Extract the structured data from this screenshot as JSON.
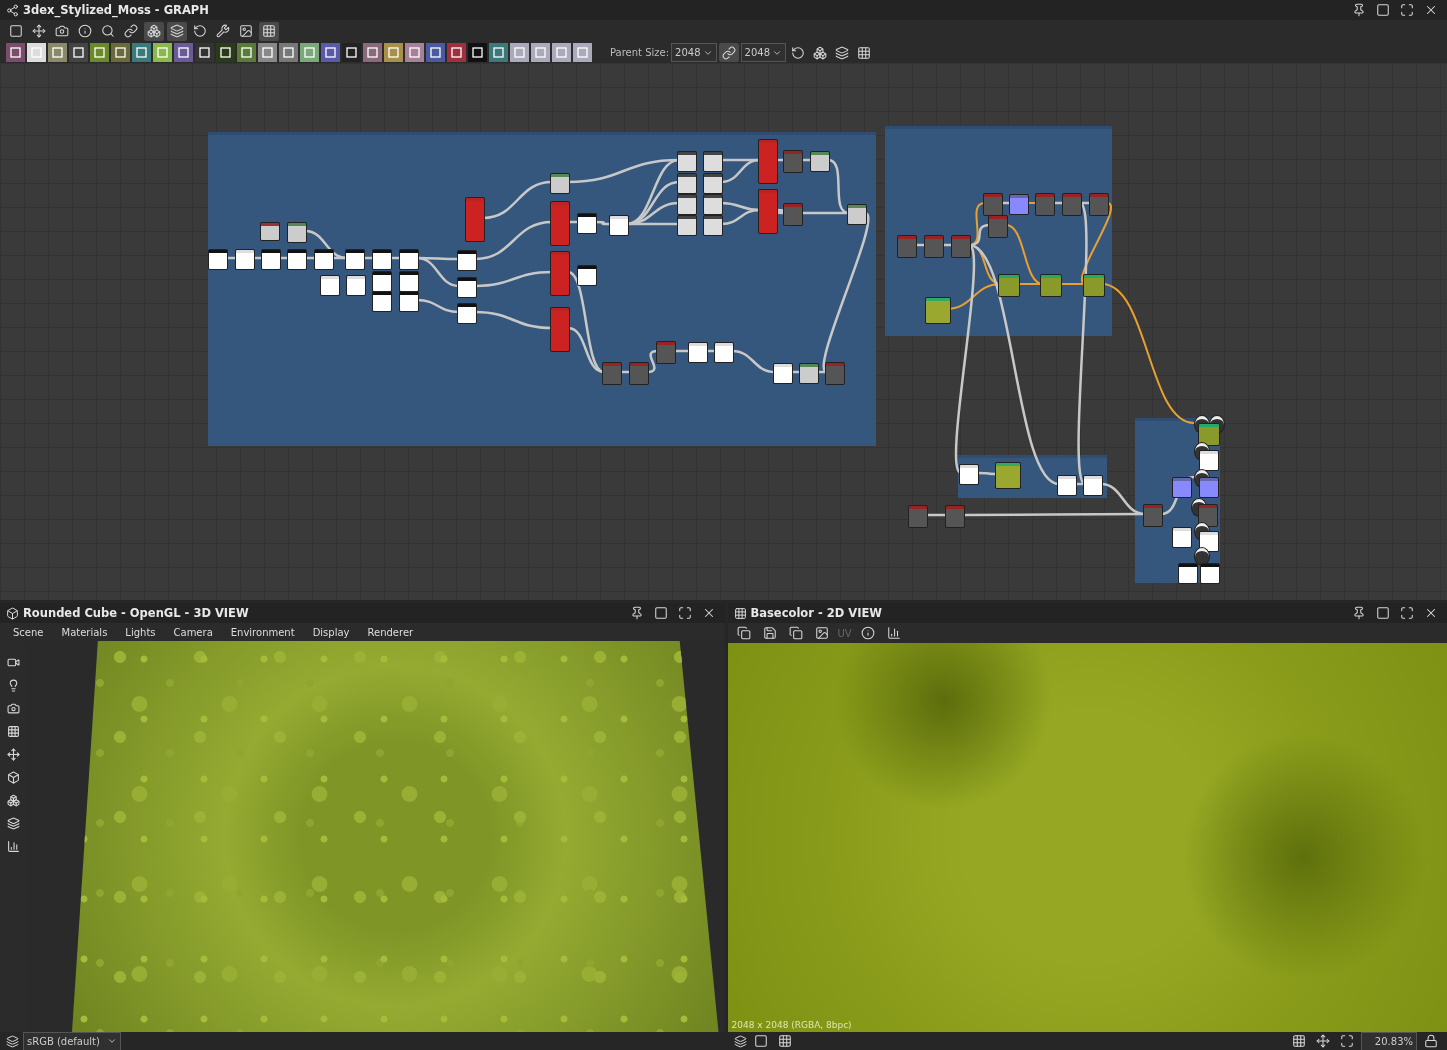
{
  "graph": {
    "title": "3dex_Stylized_Moss - GRAPH",
    "parent_size_label": "Parent Size:",
    "parent_size": "2048",
    "linked_size": "2048"
  },
  "view3d": {
    "title": "Rounded Cube - OpenGL - 3D VIEW",
    "menu": [
      "Scene",
      "Materials",
      "Lights",
      "Camera",
      "Environment",
      "Display",
      "Renderer"
    ],
    "color_space": "sRGB (default)"
  },
  "view2d": {
    "title": "Basecolor - 2D VIEW",
    "uv": "UV",
    "info": "2048 x 2048 (RGBA, 8bpc)",
    "zoom": "20.83%"
  }
}
